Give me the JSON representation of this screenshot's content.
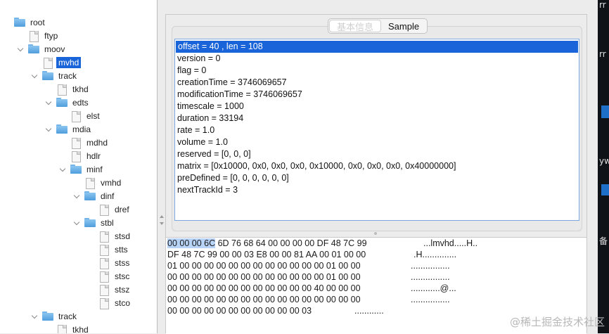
{
  "tree": {
    "nodes": [
      {
        "label": "root",
        "icon": "folder-icon",
        "toggle": "none"
      },
      {
        "label": "ftyp",
        "icon": "file-icon",
        "toggle": "none"
      },
      {
        "label": "moov",
        "icon": "folder-icon",
        "toggle": "open"
      },
      {
        "label": "mvhd",
        "icon": "file-icon",
        "toggle": "none",
        "selected": true
      },
      {
        "label": "track",
        "icon": "folder-icon",
        "toggle": "open"
      },
      {
        "label": "tkhd",
        "icon": "file-icon",
        "toggle": "none"
      },
      {
        "label": "edts",
        "icon": "folder-icon",
        "toggle": "open"
      },
      {
        "label": "elst",
        "icon": "file-icon",
        "toggle": "none"
      },
      {
        "label": "mdia",
        "icon": "folder-icon",
        "toggle": "open"
      },
      {
        "label": "mdhd",
        "icon": "file-icon",
        "toggle": "none"
      },
      {
        "label": "hdlr",
        "icon": "file-icon",
        "toggle": "none"
      },
      {
        "label": "minf",
        "icon": "folder-icon",
        "toggle": "open"
      },
      {
        "label": "vmhd",
        "icon": "file-icon",
        "toggle": "none"
      },
      {
        "label": "dinf",
        "icon": "folder-icon",
        "toggle": "open"
      },
      {
        "label": "dref",
        "icon": "file-icon",
        "toggle": "none"
      },
      {
        "label": "stbl",
        "icon": "folder-icon",
        "toggle": "open"
      },
      {
        "label": "stsd",
        "icon": "file-icon",
        "toggle": "none"
      },
      {
        "label": "stts",
        "icon": "file-icon",
        "toggle": "none"
      },
      {
        "label": "stss",
        "icon": "file-icon",
        "toggle": "none"
      },
      {
        "label": "stsc",
        "icon": "file-icon",
        "toggle": "none"
      },
      {
        "label": "stsz",
        "icon": "file-icon",
        "toggle": "none"
      },
      {
        "label": "stco",
        "icon": "file-icon",
        "toggle": "none"
      },
      {
        "label": "track",
        "icon": "folder-icon",
        "toggle": "open"
      },
      {
        "label": "tkhd",
        "icon": "file-icon",
        "toggle": "none"
      }
    ]
  },
  "tabs": [
    {
      "label": "基本信息",
      "active": true
    },
    {
      "label": "Sample",
      "active": false
    }
  ],
  "info_lines": [
    "offset = 40 , len = 108",
    "version = 0",
    "flag = 0",
    "creationTime = 3746069657",
    "modificationTime = 3746069657",
    "timescale = 1000",
    "duration = 33194",
    "rate = 1.0",
    "volume = 1.0",
    "reserved = [0, 0, 0]",
    "matrix = [0x10000, 0x0, 0x0, 0x0, 0x10000, 0x0, 0x0, 0x0, 0x40000000]",
    "preDefined = [0, 0, 0, 0, 0, 0]",
    "nextTrackId = 3"
  ],
  "hex_rows": [
    {
      "highlight": "00 00 00 6C",
      "bytes": " 6D 76 68 64 00 00 00 00 DF 48 7C 99",
      "ascii": "...lmvhd.....H.."
    },
    {
      "highlight": "",
      "bytes": "DF 48 7C 99 00 00 03 E8 00 00 81 AA 00 01 00 00",
      "ascii": ".H.............."
    },
    {
      "highlight": "",
      "bytes": "01 00 00 00 00 00 00 00 00 00 00 00 00 01 00 00",
      "ascii": "................"
    },
    {
      "highlight": "",
      "bytes": "00 00 00 00 00 00 00 00 00 00 00 00 00 01 00 00",
      "ascii": "................"
    },
    {
      "highlight": "",
      "bytes": "00 00 00 00 00 00 00 00 00 00 00 00 40 00 00 00",
      "ascii": "............@..."
    },
    {
      "highlight": "",
      "bytes": "00 00 00 00 00 00 00 00 00 00 00 00 00 00 00 00",
      "ascii": "................"
    },
    {
      "highlight": "",
      "bytes": "00 00 00 00 00 00 00 00 00 00 00 03",
      "ascii": "............"
    }
  ],
  "background_window": {
    "glyphs": [
      "rr",
      "rr",
      "yw",
      "备"
    ]
  },
  "watermark": "@稀土掘金技术社区",
  "colors": {
    "selection": "#1864d8",
    "hex_highlight": "#b7d3f7"
  }
}
